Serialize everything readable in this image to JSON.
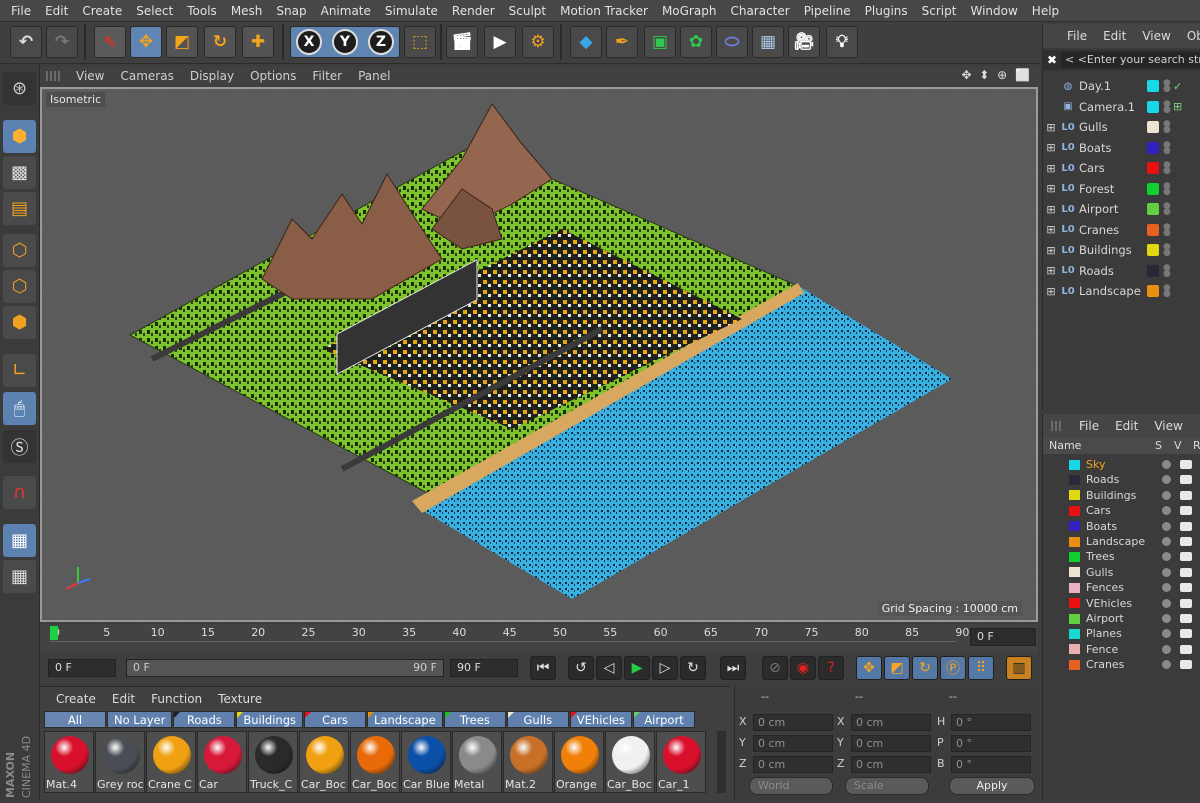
{
  "menubar": [
    "File",
    "Edit",
    "Create",
    "Select",
    "Tools",
    "Mesh",
    "Snap",
    "Animate",
    "Simulate",
    "Render",
    "Sculpt",
    "Motion Tracker",
    "MoGraph",
    "Character",
    "Pipeline",
    "Plugins",
    "Script",
    "Window",
    "Help"
  ],
  "toolbar": {
    "undo": "undo-icon",
    "redo": "redo-icon",
    "live_selection": "pointer-icon",
    "move": "move-icon",
    "scale": "scale-icon",
    "rotate": "rotate-icon",
    "cross": "move-icon",
    "axis_x": "X",
    "axis_y": "Y",
    "axis_z": "Z",
    "coord_system": "coordinate-system-icon",
    "render_view": "clapper-icon",
    "render_picture": "clapper-icon",
    "render_settings": "clapper-gear-icon",
    "cube": "cube-icon",
    "pen": "pen-icon",
    "subdivision": "cube-cage-icon",
    "cloner": "cloner-icon",
    "deformer": "deformer-icon",
    "floor": "floor-icon",
    "camera": "camera-icon",
    "light": "light-icon"
  },
  "viewport": {
    "menu": [
      "View",
      "Cameras",
      "Display",
      "Options",
      "Filter",
      "Panel"
    ],
    "nav_icons": "✥ ⬍ ⊕ ⬜",
    "camera_label": "Isometric",
    "grid_spacing": "Grid Spacing : 10000 cm"
  },
  "timeline": {
    "ticks": [
      "0",
      "5",
      "10",
      "15",
      "20",
      "25",
      "30",
      "35",
      "40",
      "45",
      "50",
      "55",
      "60",
      "65",
      "70",
      "75",
      "80",
      "85",
      "90"
    ],
    "current_frame": "0 F"
  },
  "controls": {
    "start_field": "0 F",
    "range_start": "0 F",
    "range_end": "90 F",
    "end_field": "90 F"
  },
  "material_manager": {
    "menu": [
      "Create",
      "Edit",
      "Function",
      "Texture"
    ],
    "tabs": [
      {
        "label": "All",
        "color": ""
      },
      {
        "label": "No Layer",
        "color": ""
      },
      {
        "label": "Roads",
        "color": "#202028"
      },
      {
        "label": "Buildings",
        "color": "#e8dc10"
      },
      {
        "label": "Cars",
        "color": "#e81010"
      },
      {
        "label": "Landscape",
        "color": "#e89010"
      },
      {
        "label": "Trees",
        "color": "#10c820"
      },
      {
        "label": "Gulls",
        "color": "#e8e8d0"
      },
      {
        "label": "VEhicles",
        "color": "#e81010"
      },
      {
        "label": "Airport",
        "color": "#60d060"
      }
    ],
    "materials": [
      {
        "name": "Mat.4",
        "color": "#d8102c"
      },
      {
        "name": "Grey roc",
        "color": "#4a4e54"
      },
      {
        "name": "Crane C",
        "color": "#f0a010"
      },
      {
        "name": "Car",
        "color": "#d81838"
      },
      {
        "name": "Truck_C",
        "color": "#2a2a2a"
      },
      {
        "name": "Car_Boc",
        "color": "#f0a010"
      },
      {
        "name": "Car_Boc",
        "color": "#e86a08"
      },
      {
        "name": "Car Blue",
        "color": "#0a4fa8"
      },
      {
        "name": "Metal",
        "color": "#8a8a8a"
      },
      {
        "name": "Mat.2",
        "color": "#c87028"
      },
      {
        "name": "Orange",
        "color": "#f08008"
      },
      {
        "name": "Car_Boc",
        "color": "#f0f0f0"
      },
      {
        "name": "Car_1",
        "color": "#d8102c"
      }
    ]
  },
  "attributes": {
    "header": [
      "--",
      "--",
      "--"
    ],
    "rows": [
      {
        "a": "X",
        "av": "0 cm",
        "b": "X",
        "bv": "0 cm",
        "c": "H",
        "cv": "0 °"
      },
      {
        "a": "Y",
        "av": "0 cm",
        "b": "Y",
        "bv": "0 cm",
        "c": "P",
        "cv": "0 °"
      },
      {
        "a": "Z",
        "av": "0 cm",
        "b": "Z",
        "bv": "0 cm",
        "c": "B",
        "cv": "0 °"
      }
    ],
    "world": "World",
    "scale": "Scale",
    "apply": "Apply"
  },
  "object_manager": {
    "menu": [
      "File",
      "Edit",
      "View",
      "Obje"
    ],
    "search_placeholder": "< <Enter your search stri",
    "objects": [
      {
        "name": "Day.1",
        "icon": "sky-icon",
        "color": "#18d8e8",
        "expand": "",
        "check": "✓"
      },
      {
        "name": "Camera.1",
        "icon": "camera-icon",
        "color": "#18d8e8",
        "expand": "",
        "check": "⊞"
      },
      {
        "name": "Gulls",
        "icon": "null-icon",
        "color": "#ece4d0",
        "expand": "+",
        "check": ""
      },
      {
        "name": "Boats",
        "icon": "null-icon",
        "color": "#3020c0",
        "expand": "+",
        "check": ""
      },
      {
        "name": "Cars",
        "icon": "null-icon",
        "color": "#e81010",
        "expand": "+",
        "check": ""
      },
      {
        "name": "Forest",
        "icon": "null-icon",
        "color": "#10d030",
        "expand": "+",
        "check": ""
      },
      {
        "name": "Airport",
        "icon": "null-icon",
        "color": "#60d040",
        "expand": "+",
        "check": ""
      },
      {
        "name": "Cranes",
        "icon": "null-icon",
        "color": "#e86020",
        "expand": "+",
        "check": ""
      },
      {
        "name": "Buildings",
        "icon": "null-icon",
        "color": "#e0d810",
        "expand": "+",
        "check": ""
      },
      {
        "name": "Roads",
        "icon": "null-icon",
        "color": "#282838",
        "expand": "+",
        "check": ""
      },
      {
        "name": "Landscape",
        "icon": "null-icon",
        "color": "#e89010",
        "expand": "+",
        "check": ""
      }
    ]
  },
  "layer_manager": {
    "menu": [
      "File",
      "Edit",
      "View"
    ],
    "columns": [
      "Name",
      "S",
      "V",
      "R"
    ],
    "layers": [
      {
        "name": "Sky",
        "color": "#18d8e8",
        "active": true
      },
      {
        "name": "Roads",
        "color": "#282838",
        "active": false
      },
      {
        "name": "Buildings",
        "color": "#e0d810",
        "active": false
      },
      {
        "name": "Cars",
        "color": "#e81010",
        "active": false
      },
      {
        "name": "Boats",
        "color": "#3020c0",
        "active": false
      },
      {
        "name": "Landscape",
        "color": "#e89010",
        "active": false
      },
      {
        "name": "Trees",
        "color": "#10d030",
        "active": false
      },
      {
        "name": "Gulls",
        "color": "#ece4d0",
        "active": false
      },
      {
        "name": "Fences",
        "color": "#e8b0c0",
        "active": false
      },
      {
        "name": "VEhicles",
        "color": "#e81010",
        "active": false
      },
      {
        "name": "Airport",
        "color": "#60d040",
        "active": false
      },
      {
        "name": "Planes",
        "color": "#18d8d0",
        "active": false
      },
      {
        "name": "Fence",
        "color": "#e8b0b0",
        "active": false
      },
      {
        "name": "Cranes",
        "color": "#e86020",
        "active": false
      }
    ]
  },
  "brand": {
    "line1": "MAXON",
    "line2": "CINEMA 4D"
  },
  "colors": {
    "accent": "#f2a41c",
    "selected_blue": "#5b82b0",
    "ground": "#7cc82a",
    "water": "#3aa8d8",
    "mountain": "#8a6048"
  }
}
